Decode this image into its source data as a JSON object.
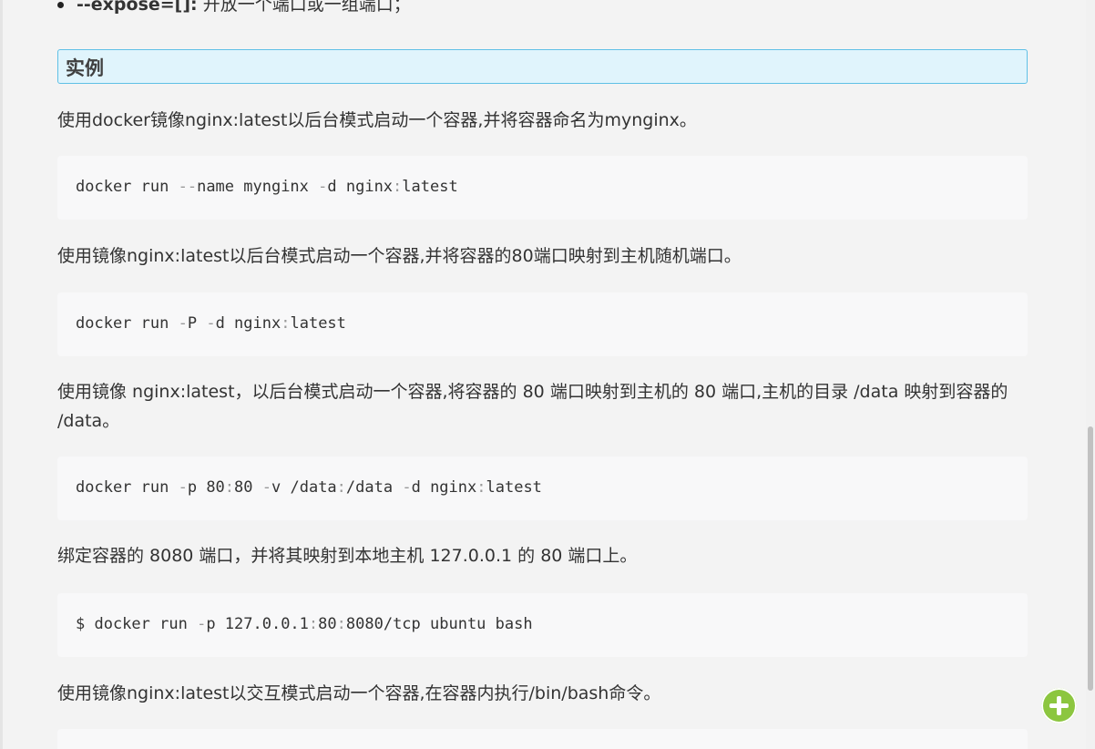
{
  "top_item": {
    "option": "--expose=[]:",
    "desc": " 开放一个端口或一组端口；"
  },
  "example_header": "实例",
  "blocks": [
    {
      "para": "使用docker镜像nginx:latest以后台模式启动一个容器,并将容器命名为mynginx。",
      "code": [
        "docker run ",
        "--",
        "name mynginx ",
        "-",
        "d nginx",
        ":",
        "latest"
      ]
    },
    {
      "para": "使用镜像nginx:latest以后台模式启动一个容器,并将容器的80端口映射到主机随机端口。",
      "code": [
        "docker run ",
        "-",
        "P ",
        "-",
        "d nginx",
        ":",
        "latest"
      ]
    },
    {
      "para": "使用镜像 nginx:latest，以后台模式启动一个容器,将容器的 80 端口映射到主机的 80 端口,主机的目录 /data 映射到容器的 /data。",
      "code": [
        "docker run ",
        "-",
        "p 80",
        ":",
        "80 ",
        "-",
        "v /data",
        ":",
        "/data ",
        "-",
        "d nginx",
        ":",
        "latest"
      ]
    },
    {
      "para": "绑定容器的 8080 端口，并将其映射到本地主机 127.0.0.1 的 80 端口上。",
      "code": [
        "$ docker run ",
        "-",
        "p 127.0.0.1",
        ":",
        "80",
        ":",
        "8080/tcp ubuntu bash"
      ]
    },
    {
      "para": "使用镜像nginx:latest以交互模式启动一个容器,在容器内执行/bin/bash命令。",
      "code": []
    }
  ]
}
